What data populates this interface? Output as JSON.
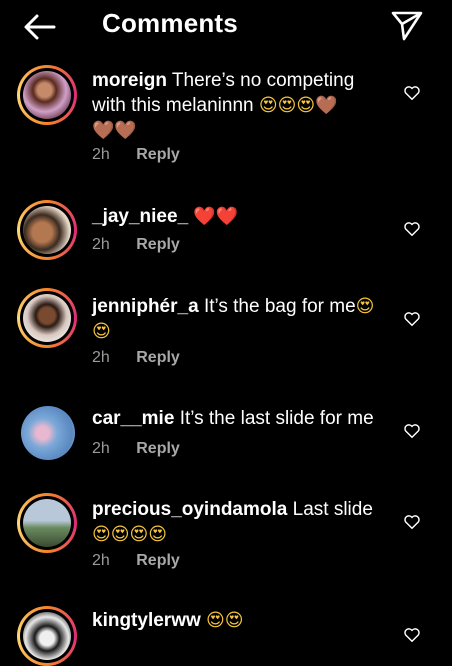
{
  "header": {
    "title": "Comments",
    "back_icon": "arrow-left-icon",
    "send_icon": "paper-plane-icon"
  },
  "comments": [
    {
      "username": "moreign",
      "text": "There’s no competing with this melaninnn",
      "emojis_inline": "😍😍😍🤎",
      "emojis_line2": "🤎🤎",
      "time": "2h",
      "reply": "Reply"
    },
    {
      "username": "_jay_niee_",
      "text": "",
      "emojis_inline": "❤️❤️",
      "time": "2h",
      "reply": "Reply"
    },
    {
      "username": "jenniphér_a",
      "text": "It’s the bag for me",
      "emojis_inline": "😍",
      "emojis_line2": "😍",
      "time": "2h",
      "reply": "Reply"
    },
    {
      "username": "car__mie",
      "text": "It’s the last slide for me",
      "time": "2h",
      "reply": "Reply"
    },
    {
      "username": "precious_oyindamola",
      "text": "Last slide",
      "emojis_line2": "😍😍😍😍",
      "time": "2h",
      "reply": "Reply"
    },
    {
      "username": "kingtylerww",
      "text": "",
      "emojis_inline": "😍😍"
    }
  ],
  "colors": {
    "background": "#000000",
    "meta_text": "#9a9a9a",
    "story_ring": "#dd2a7b"
  }
}
